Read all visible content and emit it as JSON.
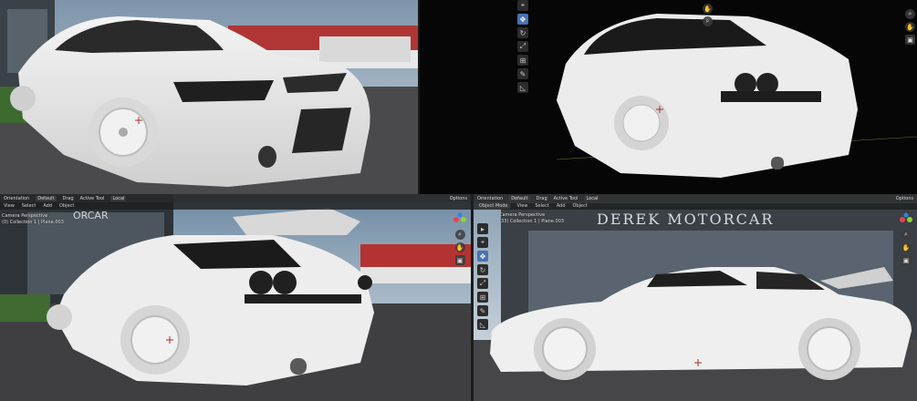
{
  "viewport_bl": {
    "header": {
      "orientation": "Orientation",
      "orientation_value": "Default",
      "drag": "Drag",
      "active_tool": "Active Tool",
      "pivot": "Local",
      "options": "Options"
    },
    "menu": [
      "View",
      "Select",
      "Add",
      "Object"
    ],
    "info_line1": "Camera Perspective",
    "info_line2": "(0) Collection 1 | Plane.003",
    "sign": "ORCAR"
  },
  "viewport_br": {
    "header": {
      "orientation": "Orientation",
      "orientation_value": "Default",
      "drag": "Drag",
      "active_tool": "Active Tool",
      "pivot": "Local",
      "options": "Options"
    },
    "mode": "Object Mode",
    "menu": [
      "View",
      "Select",
      "Add",
      "Object"
    ],
    "info_line1": "Camera Perspective",
    "info_line2": "(33) Collection 1 | Plane.003",
    "sign": "DEREK MOTORCAR"
  },
  "colors": {
    "accent": "#4772b3",
    "axis_x": "#e8434f",
    "axis_y": "#8ad62a",
    "axis_z": "#2f83e3"
  }
}
